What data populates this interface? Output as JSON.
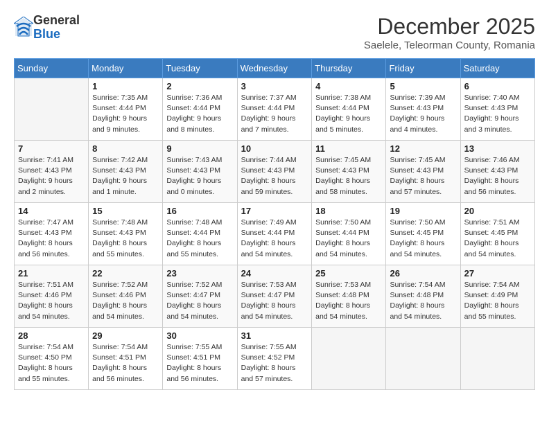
{
  "header": {
    "logo_general": "General",
    "logo_blue": "Blue",
    "month_title": "December 2025",
    "location": "Saelele, Teleorman County, Romania"
  },
  "days_of_week": [
    "Sunday",
    "Monday",
    "Tuesday",
    "Wednesday",
    "Thursday",
    "Friday",
    "Saturday"
  ],
  "weeks": [
    [
      {
        "day": "",
        "sunrise": "",
        "sunset": "",
        "daylight": ""
      },
      {
        "day": "1",
        "sunrise": "Sunrise: 7:35 AM",
        "sunset": "Sunset: 4:44 PM",
        "daylight": "Daylight: 9 hours and 9 minutes."
      },
      {
        "day": "2",
        "sunrise": "Sunrise: 7:36 AM",
        "sunset": "Sunset: 4:44 PM",
        "daylight": "Daylight: 9 hours and 8 minutes."
      },
      {
        "day": "3",
        "sunrise": "Sunrise: 7:37 AM",
        "sunset": "Sunset: 4:44 PM",
        "daylight": "Daylight: 9 hours and 7 minutes."
      },
      {
        "day": "4",
        "sunrise": "Sunrise: 7:38 AM",
        "sunset": "Sunset: 4:44 PM",
        "daylight": "Daylight: 9 hours and 5 minutes."
      },
      {
        "day": "5",
        "sunrise": "Sunrise: 7:39 AM",
        "sunset": "Sunset: 4:43 PM",
        "daylight": "Daylight: 9 hours and 4 minutes."
      },
      {
        "day": "6",
        "sunrise": "Sunrise: 7:40 AM",
        "sunset": "Sunset: 4:43 PM",
        "daylight": "Daylight: 9 hours and 3 minutes."
      }
    ],
    [
      {
        "day": "7",
        "sunrise": "Sunrise: 7:41 AM",
        "sunset": "Sunset: 4:43 PM",
        "daylight": "Daylight: 9 hours and 2 minutes."
      },
      {
        "day": "8",
        "sunrise": "Sunrise: 7:42 AM",
        "sunset": "Sunset: 4:43 PM",
        "daylight": "Daylight: 9 hours and 1 minute."
      },
      {
        "day": "9",
        "sunrise": "Sunrise: 7:43 AM",
        "sunset": "Sunset: 4:43 PM",
        "daylight": "Daylight: 9 hours and 0 minutes."
      },
      {
        "day": "10",
        "sunrise": "Sunrise: 7:44 AM",
        "sunset": "Sunset: 4:43 PM",
        "daylight": "Daylight: 8 hours and 59 minutes."
      },
      {
        "day": "11",
        "sunrise": "Sunrise: 7:45 AM",
        "sunset": "Sunset: 4:43 PM",
        "daylight": "Daylight: 8 hours and 58 minutes."
      },
      {
        "day": "12",
        "sunrise": "Sunrise: 7:45 AM",
        "sunset": "Sunset: 4:43 PM",
        "daylight": "Daylight: 8 hours and 57 minutes."
      },
      {
        "day": "13",
        "sunrise": "Sunrise: 7:46 AM",
        "sunset": "Sunset: 4:43 PM",
        "daylight": "Daylight: 8 hours and 56 minutes."
      }
    ],
    [
      {
        "day": "14",
        "sunrise": "Sunrise: 7:47 AM",
        "sunset": "Sunset: 4:43 PM",
        "daylight": "Daylight: 8 hours and 56 minutes."
      },
      {
        "day": "15",
        "sunrise": "Sunrise: 7:48 AM",
        "sunset": "Sunset: 4:43 PM",
        "daylight": "Daylight: 8 hours and 55 minutes."
      },
      {
        "day": "16",
        "sunrise": "Sunrise: 7:48 AM",
        "sunset": "Sunset: 4:44 PM",
        "daylight": "Daylight: 8 hours and 55 minutes."
      },
      {
        "day": "17",
        "sunrise": "Sunrise: 7:49 AM",
        "sunset": "Sunset: 4:44 PM",
        "daylight": "Daylight: 8 hours and 54 minutes."
      },
      {
        "day": "18",
        "sunrise": "Sunrise: 7:50 AM",
        "sunset": "Sunset: 4:44 PM",
        "daylight": "Daylight: 8 hours and 54 minutes."
      },
      {
        "day": "19",
        "sunrise": "Sunrise: 7:50 AM",
        "sunset": "Sunset: 4:45 PM",
        "daylight": "Daylight: 8 hours and 54 minutes."
      },
      {
        "day": "20",
        "sunrise": "Sunrise: 7:51 AM",
        "sunset": "Sunset: 4:45 PM",
        "daylight": "Daylight: 8 hours and 54 minutes."
      }
    ],
    [
      {
        "day": "21",
        "sunrise": "Sunrise: 7:51 AM",
        "sunset": "Sunset: 4:46 PM",
        "daylight": "Daylight: 8 hours and 54 minutes."
      },
      {
        "day": "22",
        "sunrise": "Sunrise: 7:52 AM",
        "sunset": "Sunset: 4:46 PM",
        "daylight": "Daylight: 8 hours and 54 minutes."
      },
      {
        "day": "23",
        "sunrise": "Sunrise: 7:52 AM",
        "sunset": "Sunset: 4:47 PM",
        "daylight": "Daylight: 8 hours and 54 minutes."
      },
      {
        "day": "24",
        "sunrise": "Sunrise: 7:53 AM",
        "sunset": "Sunset: 4:47 PM",
        "daylight": "Daylight: 8 hours and 54 minutes."
      },
      {
        "day": "25",
        "sunrise": "Sunrise: 7:53 AM",
        "sunset": "Sunset: 4:48 PM",
        "daylight": "Daylight: 8 hours and 54 minutes."
      },
      {
        "day": "26",
        "sunrise": "Sunrise: 7:54 AM",
        "sunset": "Sunset: 4:48 PM",
        "daylight": "Daylight: 8 hours and 54 minutes."
      },
      {
        "day": "27",
        "sunrise": "Sunrise: 7:54 AM",
        "sunset": "Sunset: 4:49 PM",
        "daylight": "Daylight: 8 hours and 55 minutes."
      }
    ],
    [
      {
        "day": "28",
        "sunrise": "Sunrise: 7:54 AM",
        "sunset": "Sunset: 4:50 PM",
        "daylight": "Daylight: 8 hours and 55 minutes."
      },
      {
        "day": "29",
        "sunrise": "Sunrise: 7:54 AM",
        "sunset": "Sunset: 4:51 PM",
        "daylight": "Daylight: 8 hours and 56 minutes."
      },
      {
        "day": "30",
        "sunrise": "Sunrise: 7:55 AM",
        "sunset": "Sunset: 4:51 PM",
        "daylight": "Daylight: 8 hours and 56 minutes."
      },
      {
        "day": "31",
        "sunrise": "Sunrise: 7:55 AM",
        "sunset": "Sunset: 4:52 PM",
        "daylight": "Daylight: 8 hours and 57 minutes."
      },
      {
        "day": "",
        "sunrise": "",
        "sunset": "",
        "daylight": ""
      },
      {
        "day": "",
        "sunrise": "",
        "sunset": "",
        "daylight": ""
      },
      {
        "day": "",
        "sunrise": "",
        "sunset": "",
        "daylight": ""
      }
    ]
  ]
}
